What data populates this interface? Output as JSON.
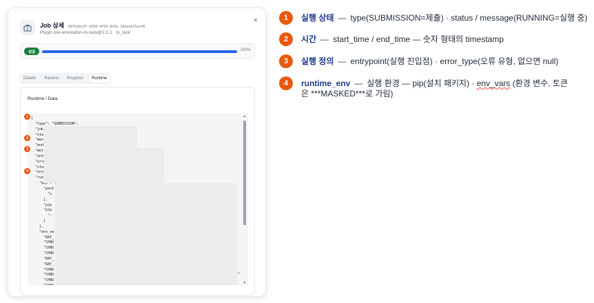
{
  "modal": {
    "title": "Job 상세",
    "job_id": "8076a6cd7-a338-4f56-829a-18eaab15ac48",
    "subtitle": "Plugin pre-annotation-to-task@2.0.2 · to_task",
    "close_glyph": "×",
    "icon": "briefcase-icon"
  },
  "progress": {
    "status_label": "성공",
    "percent": 100,
    "percent_text": "100%",
    "status_color": "#15803d",
    "bar_color": "#2563eb"
  },
  "tabs": [
    {
      "label": "Details",
      "active": false
    },
    {
      "label": "Params",
      "active": false
    },
    {
      "label": "Progress",
      "active": false
    },
    {
      "label": "Runtime",
      "active": true
    }
  ],
  "runtime": {
    "section_title": "Runtime / Data",
    "code_lines": [
      "{",
      "  \"type\": \"SUBMISSION\",",
      "  \"job",
      "  \"sta",
      "  \"mes",
      "  \"end",
      "  \"met",
      "  \"entryp",
      "  \"error_",
      "  \"start_",
      "  \"driver",
      "  \"runtim",
      "    \"pip\": .",
      "      \"pack",
      "        \"s",
      "      ],",
      "      \"pip",
      "      \"pip",
      "        \"-",
      "      ]",
      "    },",
      "    \"env_va",
      "      \"RAY_",
      "      \"SYNU",
      "      \"SYNU",
      "      \"SYNU",
      "      \"RAY_",
      "      \"RAY_",
      "      \"SYNU",
      "      \"SYNU",
      "      \"SYNU",
      "      \"SYNU"
    ],
    "trailing_glyph": "c",
    "scroll_up": "▲",
    "scroll_down": "▼"
  },
  "markers": [
    "1",
    "2",
    "3",
    "4"
  ],
  "legend": [
    {
      "num": "1",
      "key": "실행 상태",
      "sep": "—",
      "desc": "type(SUBMISSION=제출) · status / message(RUNNING=실행 중)"
    },
    {
      "num": "2",
      "key": "시간",
      "sep": "—",
      "desc": "start_time / end_time — 숫자 형태의 timestamp"
    },
    {
      "num": "3",
      "key": "실행 정의",
      "sep": "—",
      "desc": "entrypoint(실행 진입점) · error_type(오류 유형, 없으면 null)"
    },
    {
      "num": "4",
      "key": "runtime_env",
      "sep": "—",
      "desc_pre": "실행 환경 — pip(설치 패키지) · ",
      "desc_wavy": "env_vars",
      "desc_post": " (환경 변수, 토큰은 ***MASKED***로 가림)"
    }
  ],
  "colors": {
    "marker": "#ea580c",
    "key_text": "#1e3a8a"
  }
}
